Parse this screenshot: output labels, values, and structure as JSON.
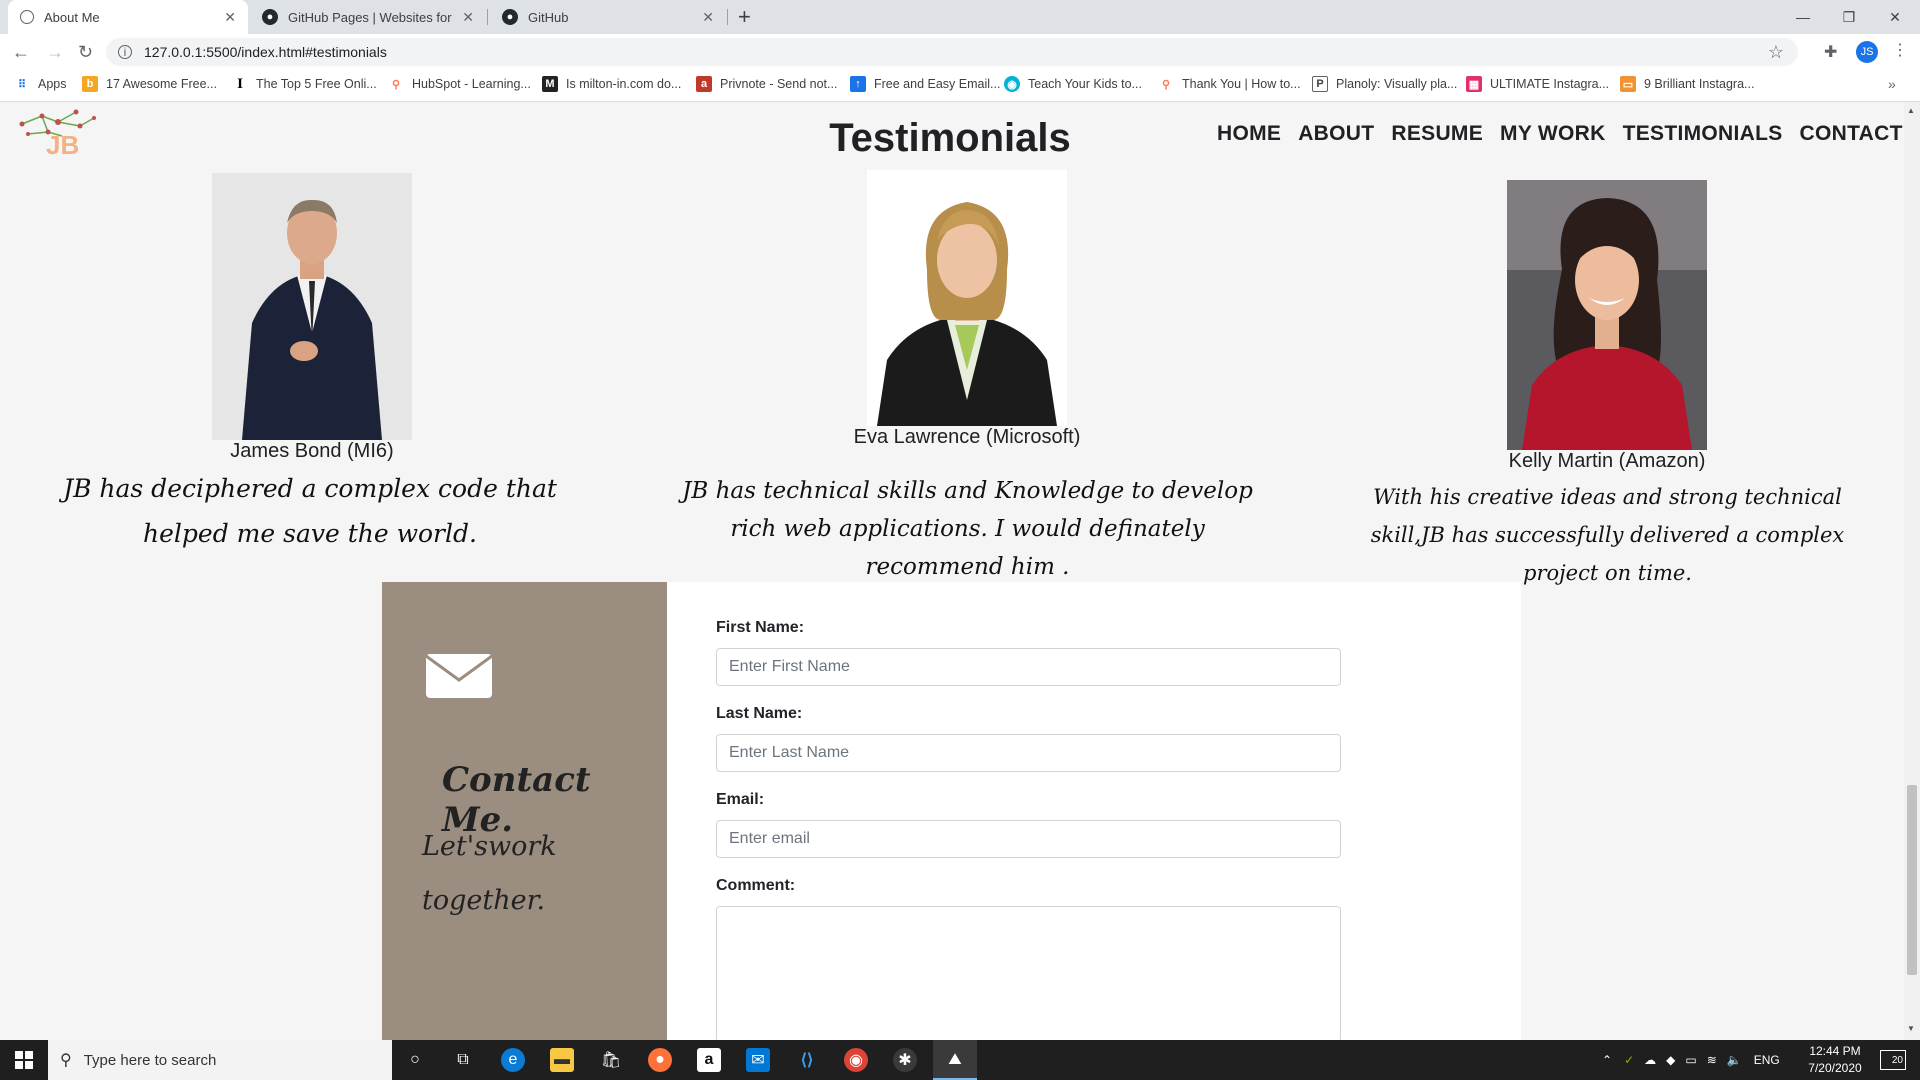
{
  "browser": {
    "tabs": [
      {
        "title": "About Me",
        "active": true
      },
      {
        "title": "GitHub Pages | Websites for you",
        "active": false
      },
      {
        "title": "GitHub",
        "active": false
      }
    ],
    "url": "127.0.0.1:5500/index.html#testimonials",
    "profile_initials": "JS",
    "bookmarks": [
      {
        "label": "Apps",
        "icon": "apps-grid-icon"
      },
      {
        "label": "17 Awesome Free...",
        "icon": "bookmark-b-icon"
      },
      {
        "label": "The Top 5 Free Onli...",
        "icon": "bookmark-i-icon"
      },
      {
        "label": "HubSpot - Learning...",
        "icon": "hubspot-icon"
      },
      {
        "label": "Is milton-in.com do...",
        "icon": "bookmark-m-icon"
      },
      {
        "label": "Privnote - Send not...",
        "icon": "privnote-icon"
      },
      {
        "label": "Free and Easy Email...",
        "icon": "email-tool-icon"
      },
      {
        "label": "Teach Your Kids to...",
        "icon": "teach-kids-icon"
      },
      {
        "label": "Thank You | How to...",
        "icon": "hubspot-icon"
      },
      {
        "label": "Planoly: Visually pla...",
        "icon": "planoly-icon"
      },
      {
        "label": "ULTIMATE Instagra...",
        "icon": "instagram-grid-icon"
      },
      {
        "label": "9 Brilliant Instagra...",
        "icon": "instagram-icon"
      }
    ]
  },
  "site": {
    "logo_text": "JB",
    "section_title": "Testimonials",
    "nav": [
      "HOME",
      "ABOUT",
      "RESUME",
      "MY WORK",
      "TESTIMONIALS",
      "CONTACT"
    ]
  },
  "testimonials": [
    {
      "name": "James Bond (MI6)",
      "quote": "JB has deciphered a complex code that helped me save the world."
    },
    {
      "name": "Eva Lawrence (Microsoft)",
      "quote": "JB has technical skills and Knowledge to develop rich web applications. I would definately recommend him ."
    },
    {
      "name": "Kelly Martin (Amazon)",
      "quote": "With his creative ideas and strong technical skill,JB has successfully delivered a complex project on time."
    }
  ],
  "contact": {
    "title": "Contact Me.",
    "subtitle": "Let'swork together.",
    "first_name_label": "First Name:",
    "first_name_placeholder": "Enter First Name",
    "last_name_label": "Last Name:",
    "last_name_placeholder": "Enter Last Name",
    "email_label": "Email:",
    "email_placeholder": "Enter email",
    "comment_label": "Comment:",
    "panel_color": "#9b8e81"
  },
  "taskbar": {
    "search_placeholder": "Type here to search",
    "language": "ENG",
    "time": "12:44 PM",
    "date": "7/20/2020",
    "notification_count": "20"
  }
}
